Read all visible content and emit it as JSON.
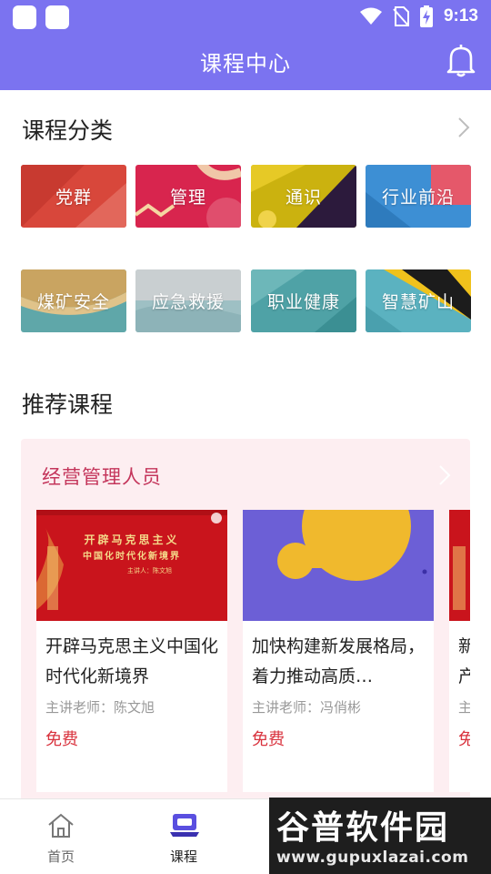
{
  "status_bar": {
    "time": "9:13"
  },
  "header": {
    "title": "课程中心"
  },
  "categories": {
    "title": "课程分类",
    "items": [
      {
        "label": "党群",
        "color": "#d8473b"
      },
      {
        "label": "管理",
        "color": "#d8254e"
      },
      {
        "label": "通识",
        "color": "#cbb20f"
      },
      {
        "label": "行业前沿",
        "color": "#3d8fd4"
      },
      {
        "label": "煤矿安全",
        "color": "#5fa7a9"
      },
      {
        "label": "应急救援",
        "color": "#9ec0c4"
      },
      {
        "label": "职业健康",
        "color": "#4fa2a6"
      },
      {
        "label": "智慧矿山",
        "color": "#5bb2c0"
      }
    ]
  },
  "recommended": {
    "title": "推荐课程",
    "group_title": "经营管理人员",
    "courses": [
      {
        "title": "开辟马克思主义中国化时代化新境界",
        "teacher": "主讲老师：陈文旭",
        "price": "免费",
        "thumb_title": "开辟马克思主义",
        "thumb_subtitle": "中国化时代化新境界",
        "thumb_speaker": "主讲人：陈文旭"
      },
      {
        "title": "加快构建新发展格局，着力推动高质…",
        "teacher": "主讲老师：冯俏彬",
        "price": "免费"
      },
      {
        "title": "新产",
        "teacher": "主",
        "price": "免"
      }
    ]
  },
  "bottom_nav": {
    "items": [
      {
        "label": "首页",
        "active": false
      },
      {
        "label": "课程",
        "active": true
      }
    ]
  },
  "watermark": {
    "brand": "谷普软件园",
    "url": "www.gupuxlazai.com"
  }
}
